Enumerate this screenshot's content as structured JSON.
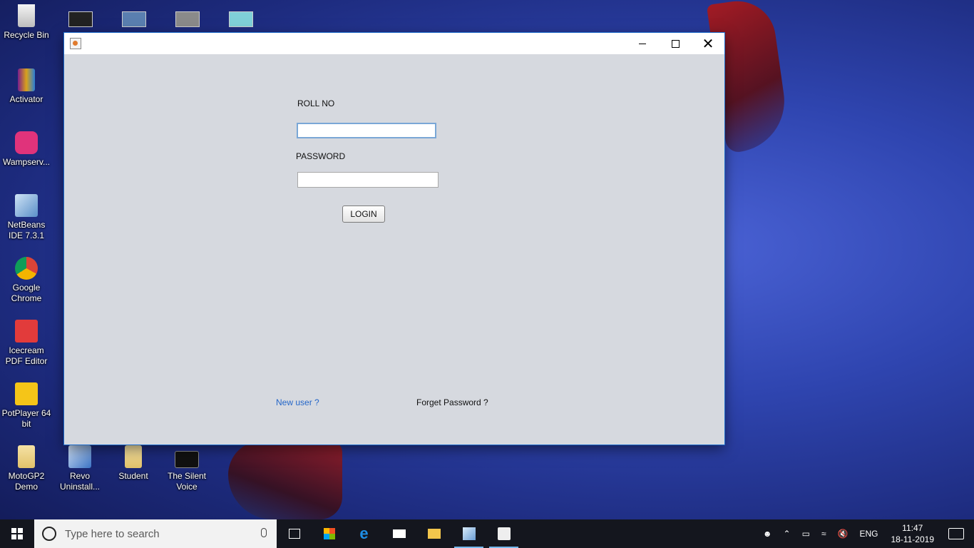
{
  "desktop": {
    "icons": [
      {
        "label": "Recycle Bin",
        "icon": "recycle-bin-icon"
      },
      {
        "label": "Activator",
        "icon": "winrar-archive-icon"
      },
      {
        "label": "Wampserv...",
        "icon": "wampserver-icon"
      },
      {
        "label": "NetBeans IDE 7.3.1",
        "icon": "netbeans-icon"
      },
      {
        "label": "Google Chrome",
        "icon": "chrome-icon"
      },
      {
        "label": "Icecream PDF Editor",
        "icon": "pdf-editor-icon"
      },
      {
        "label": "PotPlayer 64 bit",
        "icon": "potplayer-icon"
      },
      {
        "label": "MotoGP2 Demo",
        "icon": "folder-icon"
      },
      {
        "label": "Revo Uninstall...",
        "icon": "revo-uninstaller-icon"
      },
      {
        "label": "Student",
        "icon": "folder-icon"
      },
      {
        "label": "The Silent Voice",
        "icon": "video-file-icon"
      }
    ]
  },
  "window": {
    "title": "",
    "roll_label": "ROLL NO",
    "roll_value": "",
    "password_label": "PASSWORD",
    "password_value": "",
    "login_button": "LOGIN",
    "new_user_link": "New user ?",
    "forget_password_link": "Forget Password ?"
  },
  "taskbar": {
    "search_placeholder": "Type here to search",
    "language": "ENG",
    "time": "11:47",
    "date": "18-11-2019"
  },
  "colors": {
    "window_bg": "#d6d9df",
    "link_blue": "#2466c8",
    "taskbar_bg": "#14161e",
    "active_indicator": "#76b9ed"
  }
}
